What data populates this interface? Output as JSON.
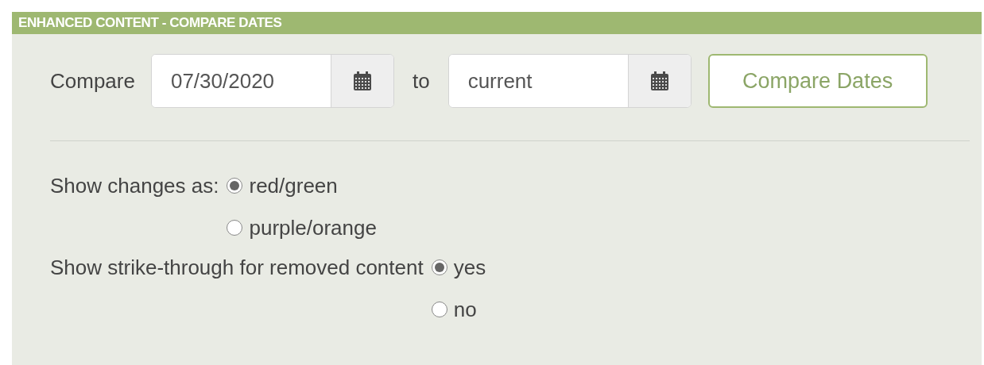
{
  "panel": {
    "title": "ENHANCED CONTENT - COMPARE DATES"
  },
  "compare": {
    "label": "Compare",
    "from": {
      "value": "07/30/2020"
    },
    "separator": "to",
    "to": {
      "value": "current"
    },
    "button": "Compare Dates"
  },
  "options": [
    {
      "label": "Show changes as:",
      "choices": [
        {
          "label": "red/green",
          "selected": true
        },
        {
          "label": "purple/orange",
          "selected": false
        }
      ]
    },
    {
      "label": "Show strike-through for removed content",
      "choices": [
        {
          "label": "yes",
          "selected": true
        },
        {
          "label": "no",
          "selected": false
        }
      ]
    }
  ]
}
